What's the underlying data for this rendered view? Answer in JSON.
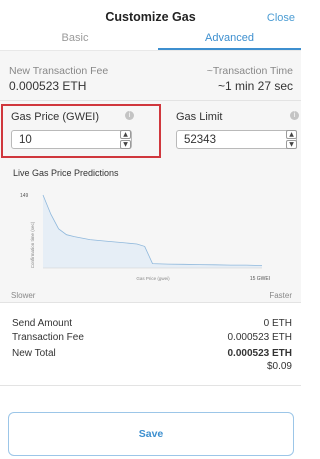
{
  "header": {
    "title": "Customize Gas",
    "close_label": "Close",
    "tabs": [
      {
        "label": "Basic",
        "active": false
      },
      {
        "label": "Advanced",
        "active": true
      }
    ]
  },
  "summary": {
    "fee_label": "New Transaction Fee",
    "fee_value": "0.000523 ETH",
    "time_label": "~Transaction Time",
    "time_value": "~1 min 27 sec"
  },
  "inputs": {
    "gas_price": {
      "label": "Gas Price (GWEI)",
      "value": "10"
    },
    "gas_limit": {
      "label": "Gas Limit",
      "value": "52343"
    }
  },
  "chart": {
    "title": "Live Gas Price Predictions",
    "slower_label": "Slower",
    "faster_label": "Faster"
  },
  "chart_data": {
    "type": "area",
    "title": "Live Gas Price Predictions",
    "xlabel": "Gas Price (gwei)",
    "ylabel": "Confirmation time (sec)",
    "x_end_label": "15 GWEI",
    "y_top_label": "149",
    "x": [
      1,
      1.5,
      2,
      2.5,
      3,
      4,
      5,
      6,
      7,
      7.5,
      8,
      9,
      10,
      11,
      12,
      13,
      14,
      15
    ],
    "y": [
      149,
      110,
      80,
      68,
      64,
      58,
      55,
      52,
      49,
      44,
      9,
      8,
      7.5,
      7,
      6.5,
      6,
      6,
      5
    ],
    "xlim": [
      1,
      15
    ],
    "ylim": [
      0,
      149
    ],
    "accent_color": "#8fb8dc",
    "fill_color": "#e6eef6"
  },
  "totals": {
    "send_amount_label": "Send Amount",
    "send_amount_value": "0 ETH",
    "transaction_fee_label": "Transaction Fee",
    "transaction_fee_value": "0.000523 ETH",
    "new_total_label": "New Total",
    "new_total_value": "0.000523 ETH",
    "new_total_fiat": "$0.09"
  },
  "save_label": "Save",
  "colors": {
    "accent": "#3d8fcf",
    "highlight": "#d0373d"
  }
}
